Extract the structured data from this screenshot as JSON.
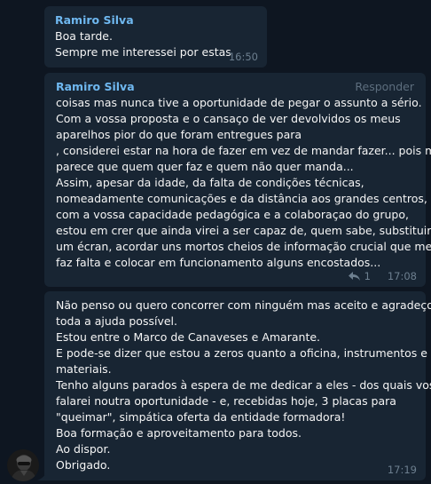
{
  "messages": [
    {
      "sender": "Ramiro Silva",
      "lines": [
        "Boa tarde.",
        "Sempre me interessei por estas"
      ],
      "time": "16:50"
    },
    {
      "sender": "Ramiro Silva",
      "reply_label": "Responder",
      "lines": [
        "coisas mas nunca tive a oportunidade de pegar o assunto a sério.",
        "Com a vossa proposta e o cansaço de ver devolvidos os meus",
        "aparelhos pior do que foram entregues para",
        ", considerei estar na hora de fazer em vez de mandar fazer... pois me",
        "parece que quem quer faz e quem não quer manda...",
        "Assim, apesar da idade, da falta de condições técnicas,",
        "nomeadamente comunicações e da distância aos grandes centros,",
        "com a vossa capacidade pedagógica e a colaboraçao do grupo,",
        "estou em crer que ainda virei a ser capaz de, quem sabe, substituir",
        "um écran, acordar uns mortos cheios de informação crucial que me",
        "faz falta e colocar em funcionamento alguns encostados..."
      ],
      "reply_count": "1",
      "time": "17:08"
    },
    {
      "lines": [
        "Não penso ou quero concorrer com ninguém mas aceito e agradeço",
        "toda a ajuda possível.",
        "Estou entre o Marco de Canaveses e Amarante.",
        "E pode-se dizer que estou a zeros quanto a oficina, instrumentos e",
        "materiais.",
        "Tenho alguns parados à espera de me dedicar a eles - dos quais vos",
        "falarei noutra oportunidade - e, recebidas hoje, 3 placas para",
        "\"queimar\", simpática oferta da entidade formadora!",
        "Boa formação e aproveitamento para todos.",
        "Ao dispor.",
        "Obrigado."
      ],
      "time": "17:19"
    }
  ],
  "colors": {
    "background": "#0e1621",
    "bubble": "#182533",
    "sender_name": "#6fb8f0",
    "text": "#f5f5f5",
    "meta": "#6d7f8f"
  }
}
